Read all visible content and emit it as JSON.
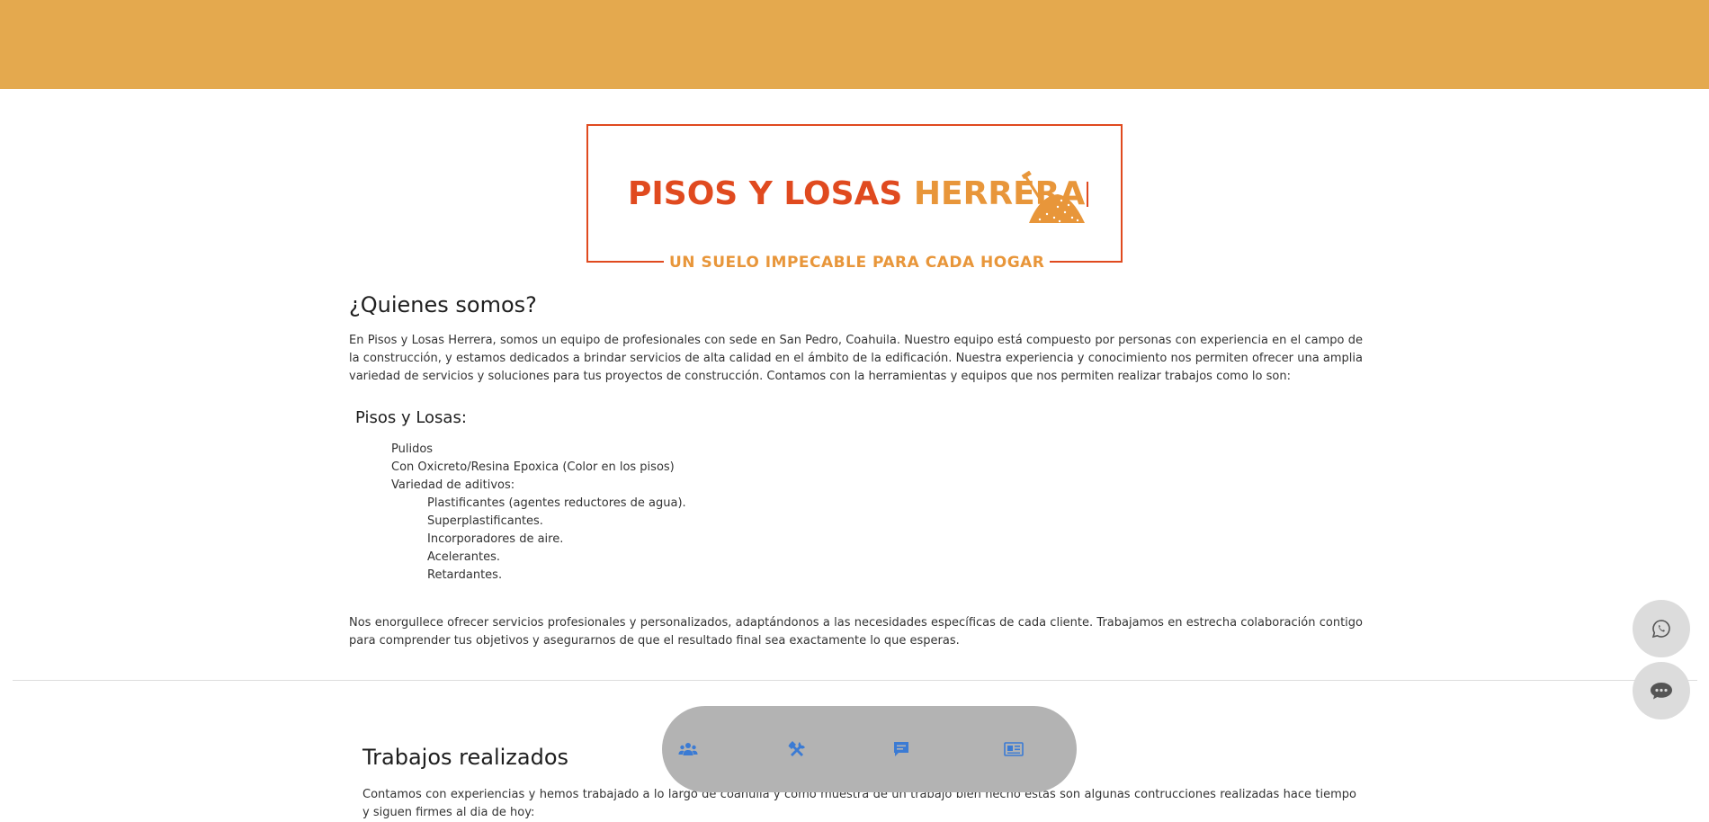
{
  "header": {
    "background_color": "#e4a94e"
  },
  "logo": {
    "word1": "PISOS Y LOSAS",
    "word2": "HERRERA",
    "tagline": "UN SUELO IMPECABLE PARA CADA HOGAR",
    "icon": "shovel-sand-icon",
    "primary_color": "#e04a1f",
    "secondary_color": "#e8963a"
  },
  "about": {
    "title": "¿Quienes somos?",
    "intro": "En Pisos y Losas Herrera, somos un equipo de profesionales con sede en San Pedro, Coahuila. Nuestro equipo está compuesto por personas con experiencia en el campo de la construcción, y estamos dedicados a brindar servicios de alta calidad en el ámbito de la edificación. Nuestra experiencia y conocimiento nos permiten ofrecer una amplia variedad de servicios y soluciones para tus proyectos de construcción. Contamos con la herramientas y equipos que nos permiten realizar trabajos como lo son:",
    "subtitle": "Pisos y Losas:",
    "items": [
      "Pulidos",
      "Con Oxicreto/Resina Epoxica (Color en los pisos)",
      "Variedad de aditivos:"
    ],
    "additives": [
      "Plastificantes (agentes reductores de agua).",
      "Superplastificantes.",
      "Incorporadores de aire.",
      "Acelerantes.",
      "Retardantes."
    ],
    "closing": "Nos enorgullece ofrecer servicios profesionales y personalizados, adaptándonos a las necesidades específicas de cada cliente. Trabajamos en estrecha colaboración contigo para comprender tus objetivos y asegurarnos de que el resultado final sea exactamente lo que esperas."
  },
  "works": {
    "title": "Trabajos realizados",
    "intro": "Contamos con experiencias y hemos trabajado a lo largo de coahuila y como muestra de un trabajo bien hecho estas son algunas contrucciones realizadas hace tiempo y siguen firmes al dia de hoy:"
  },
  "floating_buttons": [
    "whatsapp-icon",
    "chat-bubble-icon"
  ],
  "bottom_nav": {
    "icons": [
      "users-icon",
      "tools-icon",
      "message-icon",
      "contact-card-icon"
    ],
    "icon_color": "#3b7bd4"
  }
}
